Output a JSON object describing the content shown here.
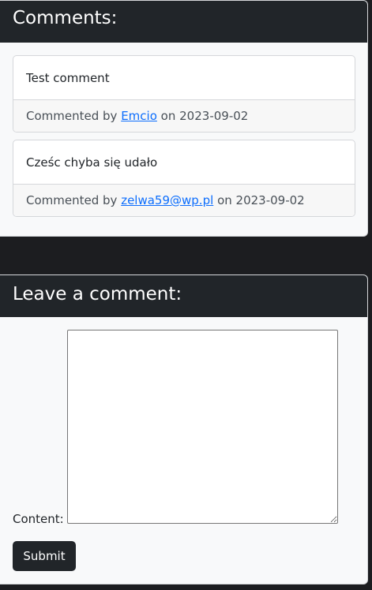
{
  "comments_section": {
    "title": "Comments:",
    "comments": [
      {
        "text": "Test comment",
        "prefix": "Commented by",
        "author": "Emcio",
        "on_word": "on",
        "date": "2023-09-02"
      },
      {
        "text": "Cześc chyba się udało",
        "prefix": "Commented by",
        "author": "zelwa59@wp.pl",
        "on_word": "on",
        "date": "2023-09-02"
      }
    ]
  },
  "leave_comment": {
    "title": "Leave a comment:",
    "content_label": "Content:",
    "content_value": "",
    "submit_label": "Submit"
  },
  "colors": {
    "page_background": "#1c1d20",
    "header_background": "#212529",
    "link": "#0d6efd"
  }
}
